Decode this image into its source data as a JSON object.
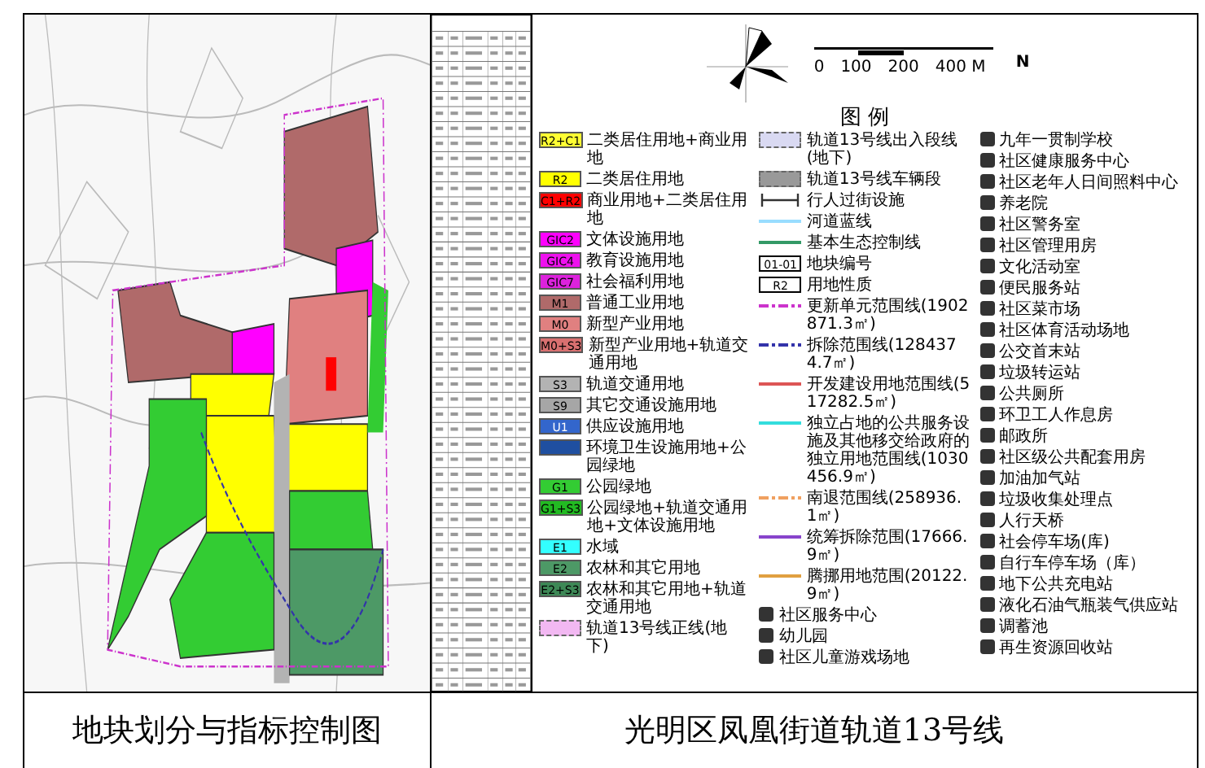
{
  "compass": {
    "north": "N",
    "scale_labels": [
      "0",
      "100",
      "200",
      "400 M"
    ]
  },
  "legend": {
    "title": "图 例",
    "items": [
      {
        "kind": "swatch",
        "code": "R2+C1",
        "label": "二类居住用地+商业用地",
        "color": "#ffff33"
      },
      {
        "kind": "swatch",
        "code": "R2",
        "label": "二类居住用地",
        "color": "#ffff00"
      },
      {
        "kind": "swatch",
        "code": "C1+R2",
        "label": "商业用地+二类居住用地",
        "color": "#ff0000"
      },
      {
        "kind": "swatch",
        "code": "GIC2",
        "label": "文体设施用地",
        "color": "#ff00ff"
      },
      {
        "kind": "swatch",
        "code": "GIC4",
        "label": "教育设施用地",
        "color": "#ee11ee"
      },
      {
        "kind": "swatch",
        "code": "GIC7",
        "label": "社会福利用地",
        "color": "#dd22dd"
      },
      {
        "kind": "swatch",
        "code": "M1",
        "label": "普通工业用地",
        "color": "#b06a6a"
      },
      {
        "kind": "swatch",
        "code": "M0",
        "label": "新型产业用地",
        "color": "#e08080"
      },
      {
        "kind": "swatch",
        "code": "M0+S3",
        "label": "新型产业用地+轨道交通用地",
        "color": "#d97070"
      },
      {
        "kind": "swatch",
        "code": "S3",
        "label": "轨道交通用地",
        "color": "#b3b3b3"
      },
      {
        "kind": "swatch",
        "code": "S9",
        "label": "其它交通设施用地",
        "color": "#a6a6a6"
      },
      {
        "kind": "swatch",
        "code": "U1",
        "label": "供应设施用地",
        "color": "#3366cc"
      },
      {
        "kind": "swatch",
        "label": "环境卫生设施用地+公园绿地",
        "color": "#1f4fa0"
      },
      {
        "kind": "swatch",
        "code": "G1",
        "label": "公园绿地",
        "color": "#33cc33"
      },
      {
        "kind": "swatch",
        "code": "G1+S3",
        "label": "公园绿地+轨道交通用地+文体设施用地",
        "color": "#22bb22"
      },
      {
        "kind": "swatch",
        "code": "E1",
        "label": "水域",
        "color": "#33ffff"
      },
      {
        "kind": "swatch",
        "code": "E2",
        "label": "农林和其它用地",
        "color": "#4d9966"
      },
      {
        "kind": "swatch",
        "code": "E2+S3",
        "label": "农林和其它用地+轨道交通用地",
        "color": "#3d8856"
      },
      {
        "kind": "band",
        "label": "轨道13号线正线(地下)",
        "color": "#f2b8f2"
      },
      {
        "kind": "band",
        "label": "轨道13号线出入段线(地下)",
        "color": "#d9d9f2"
      },
      {
        "kind": "band",
        "label": "轨道13号线车辆段",
        "color": "#999999"
      },
      {
        "kind": "crossing",
        "label": "行人过街设施",
        "color": "#333333"
      },
      {
        "kind": "line",
        "label": "河道蓝线",
        "color": "#99ddff"
      },
      {
        "kind": "line",
        "label": "基本生态控制线",
        "color": "#339966"
      },
      {
        "kind": "key",
        "code": "01-01",
        "label": "地块编号",
        "color": "#000000"
      },
      {
        "kind": "key",
        "code": "R2",
        "label": "用地性质",
        "color": "#000000"
      },
      {
        "kind": "dashline",
        "label": "更新单元范围线(1902871.3㎡)",
        "color": "#cc33cc"
      },
      {
        "kind": "dashline",
        "label": "拆除范围线(1284374.7㎡)",
        "color": "#3333aa"
      },
      {
        "kind": "line",
        "label": "开发建设用地范围线(517282.5㎡)",
        "color": "#dd5555"
      },
      {
        "kind": "line",
        "label": "独立占地的公共服务设施及其他移交给政府的独立用地范围线(1030456.9㎡)",
        "color": "#33dddd"
      },
      {
        "kind": "dashline",
        "label": "南退范围线(258936.1㎡)",
        "color": "#f0a060"
      },
      {
        "kind": "line",
        "label": "统筹拆除范围(17666.9㎡)",
        "color": "#8844cc"
      },
      {
        "kind": "line",
        "label": "腾挪用地范围(20122.9㎡)",
        "color": "#e0a040"
      }
    ],
    "facilities": [
      "社区服务中心",
      "幼儿园",
      "社区儿童游戏场地",
      "九年一贯制学校",
      "社区健康服务中心",
      "社区老年人日间照料中心",
      "养老院",
      "社区警务室",
      "社区管理用房",
      "文化活动室",
      "便民服务站",
      "社区菜市场",
      "社区体育活动场地",
      "公交首末站",
      "垃圾转运站",
      "公共厕所",
      "环卫工人作息房",
      "邮政所",
      "社区级公共配套用房",
      "加油加气站",
      "垃圾收集处理点",
      "人行天桥",
      "社会停车场(库)",
      "自行车停车场（库）",
      "地下公共充电站",
      "液化石油气瓶装气供应站",
      "调蓄池",
      "再生资源回收站"
    ]
  },
  "title_block": {
    "drawing_title": "地块划分与指标控制图",
    "project_title": "光明区凤凰街道轨道13号线"
  }
}
